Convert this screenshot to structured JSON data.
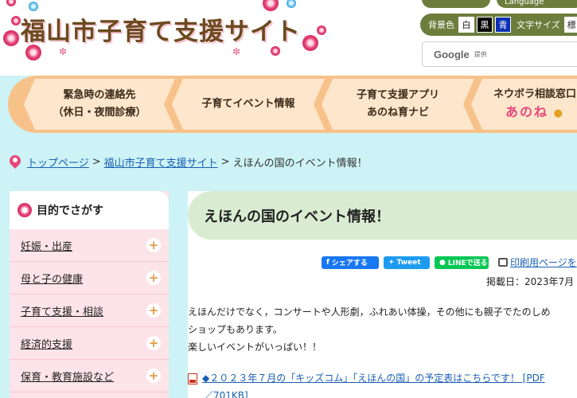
{
  "header": {
    "site_title": "福山市子育て支援サイト",
    "top_pill_1": "",
    "top_pill_2": "Language",
    "bg_color_label": "背景色",
    "color_white": "白",
    "color_black": "黒",
    "color_blue": "青",
    "font_size_label": "文字サイズ",
    "font_size_value": "標",
    "search_brand": "Google",
    "search_sub": "提供"
  },
  "nav": {
    "items": [
      {
        "line1": "緊急時の連絡先",
        "line2": "（休日・夜間診療）"
      },
      {
        "line1": "子育てイベント情報",
        "line2": ""
      },
      {
        "line1": "子育て支援アプリ",
        "line2": "あのね育ナビ"
      },
      {
        "line1": "ネウボラ相談窓口",
        "accent": "あのね"
      }
    ]
  },
  "breadcrumb": {
    "home": "トップページ",
    "sep": ">",
    "site": "福山市子育て支援サイト",
    "current": "えほんの国のイベント情報！"
  },
  "sidebar": {
    "title": "目的でさがす",
    "items": [
      "妊娠・出産",
      "母と子の健康",
      "子育て支援・相談",
      "経済的支援",
      "保育・教育施設など"
    ]
  },
  "main": {
    "title": "えほんの国のイベント情報！",
    "share_fb": "シェアする",
    "share_tw": "Tweet",
    "share_line": "LINEで送る",
    "print": "印刷用ページを",
    "posted": "掲載日：2023年7月",
    "body": [
      "えほんだけでなく，コンサートや人形劇，ふれあい体操，その他にも親子でたのしめ",
      "ショップもあります。",
      "楽しいイベントがいっぱい！！"
    ],
    "pdf_line1": "◆２０２３年７月の「キッズコム」「えほんの国」の予定表はこちらです！ [PDF",
    "pdf_line2": "／701KB]"
  },
  "colors": {
    "nav_orange": "#f7c28a",
    "nav_item": "#fde6cb",
    "band_cyan": "#cdf3f6",
    "sidebar_pink": "#fde3ea",
    "heading_green": "#d9ecd2",
    "access_olive": "#6c7d3c",
    "accent_pink": "#e8477a",
    "link_blue": "#1a5fb4"
  }
}
